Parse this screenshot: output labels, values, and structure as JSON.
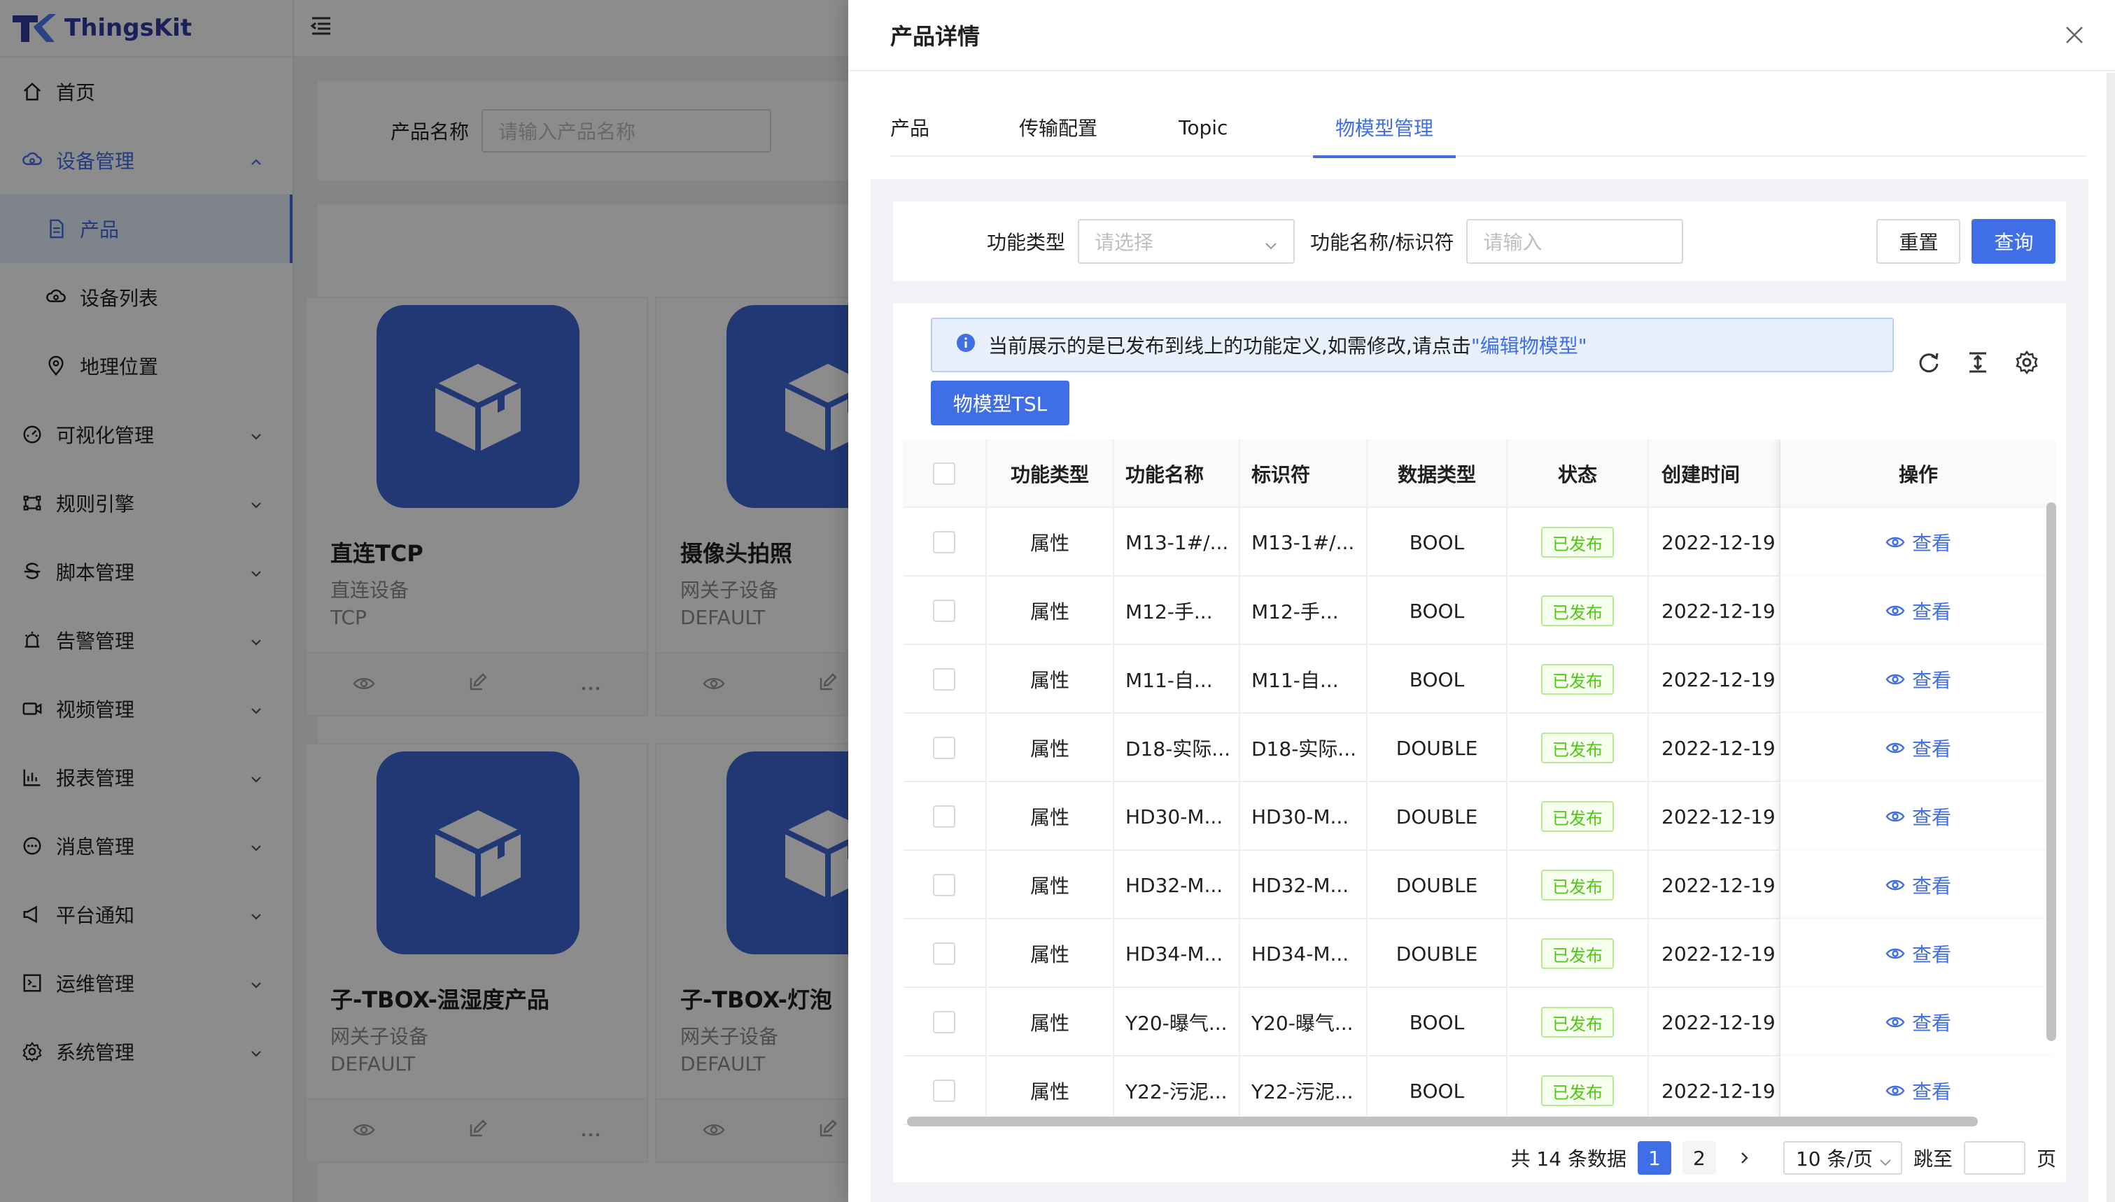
{
  "app": {
    "name": "ThingsKit"
  },
  "sidebar": {
    "items": [
      {
        "label": "首页",
        "icon": "home-icon"
      },
      {
        "label": "设备管理",
        "icon": "cloud-device-icon",
        "expanded": true
      },
      {
        "label": "产品",
        "icon": "file-icon",
        "selected": true
      },
      {
        "label": "设备列表",
        "icon": "device-list-icon"
      },
      {
        "label": "地理位置",
        "icon": "location-icon"
      },
      {
        "label": "可视化管理",
        "icon": "dashboard-icon"
      },
      {
        "label": "规则引擎",
        "icon": "rule-icon"
      },
      {
        "label": "脚本管理",
        "icon": "script-icon"
      },
      {
        "label": "告警管理",
        "icon": "alarm-icon"
      },
      {
        "label": "视频管理",
        "icon": "video-icon"
      },
      {
        "label": "报表管理",
        "icon": "chart-icon"
      },
      {
        "label": "消息管理",
        "icon": "message-icon"
      },
      {
        "label": "平台通知",
        "icon": "notice-icon"
      },
      {
        "label": "运维管理",
        "icon": "ops-icon"
      },
      {
        "label": "系统管理",
        "icon": "settings-icon"
      }
    ]
  },
  "background": {
    "search_label": "产品名称",
    "search_placeholder": "请输入产品名称",
    "cards": [
      {
        "title": "直连TCP",
        "type": "直连设备",
        "protocol": "TCP"
      },
      {
        "title": "摄像头拍照",
        "type": "网关子设备",
        "protocol": "DEFAULT"
      },
      {
        "title": "子-TBOX-温湿度产品",
        "type": "网关子设备",
        "protocol": "DEFAULT"
      },
      {
        "title": "子-TBOX-灯泡",
        "type": "网关子设备",
        "protocol": "DEFAULT"
      }
    ]
  },
  "drawer": {
    "title": "产品详情",
    "tabs": [
      "产品",
      "传输配置",
      "Topic",
      "物模型管理"
    ],
    "active_tab": 3,
    "filter": {
      "type_label": "功能类型",
      "type_placeholder": "请选择",
      "name_label": "功能名称/标识符",
      "name_placeholder": "请输入",
      "reset": "重置",
      "query": "查询"
    },
    "alert": {
      "text": "当前展示的是已发布到线上的功能定义,如需修改,请点击",
      "link": "\"编辑物模型\""
    },
    "tsl_button": "物模型TSL",
    "table": {
      "columns": [
        "功能类型",
        "功能名称",
        "标识符",
        "数据类型",
        "状态",
        "创建时间",
        "操作"
      ],
      "rows": [
        {
          "type": "属性",
          "name": "M13-1#/...",
          "identifier": "M13-1#/...",
          "data_type": "BOOL",
          "status": "已发布",
          "created": "2022-12-19",
          "action": "查看"
        },
        {
          "type": "属性",
          "name": "M12-手...",
          "identifier": "M12-手...",
          "data_type": "BOOL",
          "status": "已发布",
          "created": "2022-12-19",
          "action": "查看"
        },
        {
          "type": "属性",
          "name": "M11-自...",
          "identifier": "M11-自...",
          "data_type": "BOOL",
          "status": "已发布",
          "created": "2022-12-19",
          "action": "查看"
        },
        {
          "type": "属性",
          "name": "D18-实际...",
          "identifier": "D18-实际...",
          "data_type": "DOUBLE",
          "status": "已发布",
          "created": "2022-12-19",
          "action": "查看"
        },
        {
          "type": "属性",
          "name": "HD30-M...",
          "identifier": "HD30-M...",
          "data_type": "DOUBLE",
          "status": "已发布",
          "created": "2022-12-19",
          "action": "查看"
        },
        {
          "type": "属性",
          "name": "HD32-M...",
          "identifier": "HD32-M...",
          "data_type": "DOUBLE",
          "status": "已发布",
          "created": "2022-12-19",
          "action": "查看"
        },
        {
          "type": "属性",
          "name": "HD34-M...",
          "identifier": "HD34-M...",
          "data_type": "DOUBLE",
          "status": "已发布",
          "created": "2022-12-19",
          "action": "查看"
        },
        {
          "type": "属性",
          "name": "Y20-曝气...",
          "identifier": "Y20-曝气...",
          "data_type": "BOOL",
          "status": "已发布",
          "created": "2022-12-19",
          "action": "查看"
        },
        {
          "type": "属性",
          "name": "Y22-污泥...",
          "identifier": "Y22-污泥...",
          "data_type": "BOOL",
          "status": "已发布",
          "created": "2022-12-19",
          "action": "查看"
        }
      ]
    },
    "pagination": {
      "total_text": "共 14 条数据",
      "pages": [
        "1",
        "2"
      ],
      "current": "1",
      "page_size": "10 条/页",
      "jump_label": "跳至",
      "page_suffix": "页"
    }
  },
  "colors": {
    "primary": "#3f6ee6",
    "success": "#52c41a",
    "mask": "rgba(0,0,0,0.45)"
  }
}
